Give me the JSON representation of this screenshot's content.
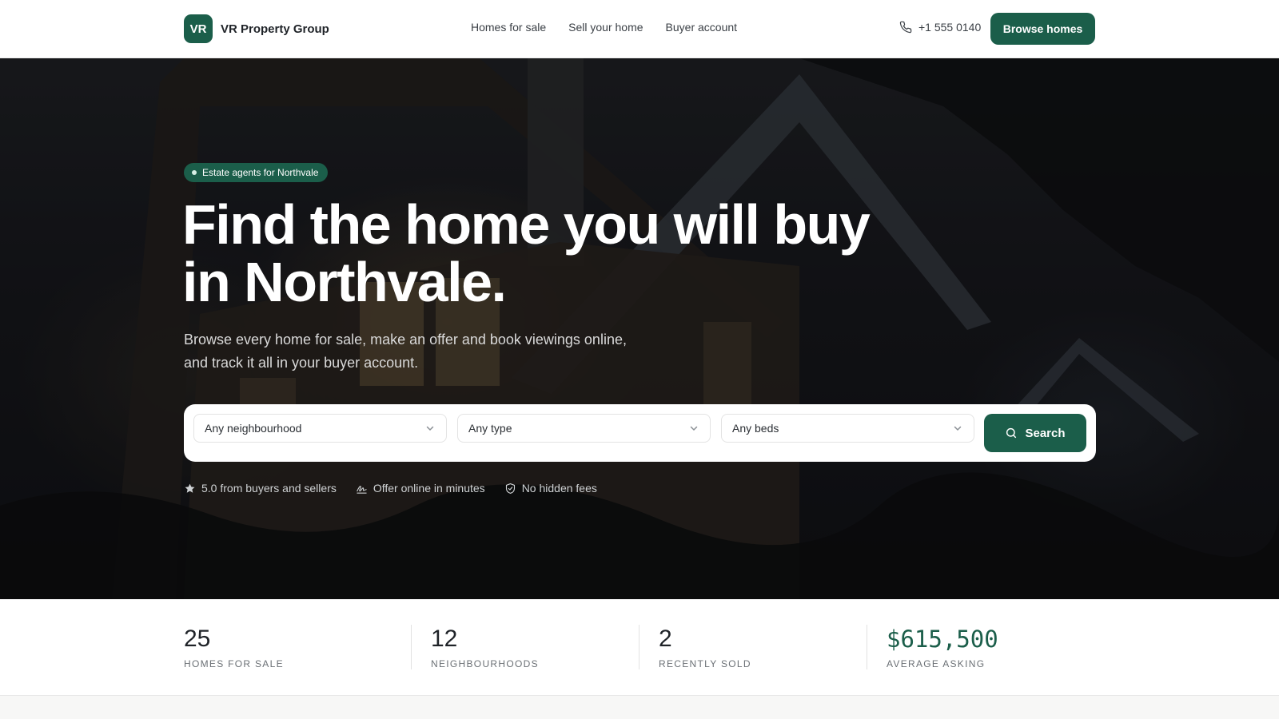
{
  "brand": {
    "logo_text": "VR",
    "name": "VR Property Group",
    "color": "#1b5e4a"
  },
  "nav": {
    "links": [
      "Homes for sale",
      "Sell your home",
      "Buyer account"
    ]
  },
  "header": {
    "phone": "+1 555 0140",
    "phone_icon": "phone-icon",
    "cta_label": "Browse homes"
  },
  "hero": {
    "badge": "Estate agents for Northvale",
    "title_line1": "Find the home you will buy",
    "title_line2": "in Northvale.",
    "subtitle": "Browse every home for sale, make an offer and book viewings online, and track it all in your buyer account."
  },
  "search": {
    "neighbourhood": "Any neighbourhood",
    "type": "Any type",
    "beds": "Any beds",
    "button_label": "Search"
  },
  "trust": {
    "rating": "5.0 from buyers and sellers",
    "offer": "Offer online in minutes",
    "fees": "No hidden fees"
  },
  "stats": [
    {
      "value": "25",
      "label": "HOMES FOR SALE"
    },
    {
      "value": "12",
      "label": "NEIGHBOURHOODS"
    },
    {
      "value": "2",
      "label": "RECENTLY SOLD"
    },
    {
      "value": "$615,500",
      "label": "AVERAGE ASKING"
    }
  ]
}
